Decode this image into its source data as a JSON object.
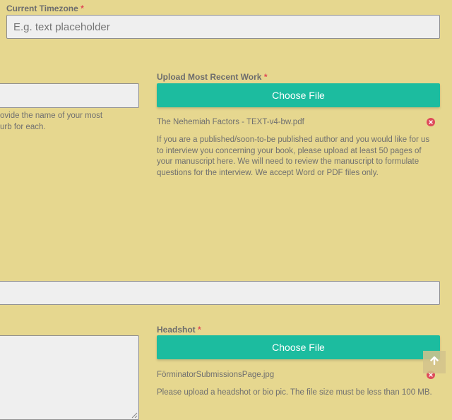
{
  "timezone": {
    "label": "Current Timezone",
    "required_mark": "*",
    "placeholder": "E.g. text placeholder"
  },
  "left_column": {
    "helper_line1": "ovide the name of your most",
    "helper_line2": "urb for each."
  },
  "upload_work": {
    "label": "Upload Most Recent Work",
    "required_mark": "*",
    "button_label": "Choose File",
    "file_name": "The Nehemiah Factors - TEXT-v4-bw.pdf",
    "help_lines": [
      "If you are a published/soon-to-be published author and you would like for us",
      "to interview you concerning your book, please upload at least 50 pages of",
      "your manuscript here. We will need to review the manuscript to formulate",
      "questions for the interview. We accept Word or PDF files only."
    ]
  },
  "headshot": {
    "label": "Headshot",
    "required_mark": "*",
    "button_label": "Choose File",
    "file_name": "FörminatorSubmissionsPage.jpg",
    "help": "Please upload a headshot or bio pic. The file size must be less than 100 MB."
  },
  "icons": {
    "remove": "close-circle-icon",
    "scroll_top": "arrow-up-icon"
  },
  "colors": {
    "background": "#e6d78f",
    "accent": "#1cbc9f",
    "required": "#e04a55",
    "remove": "#de4a5b"
  }
}
